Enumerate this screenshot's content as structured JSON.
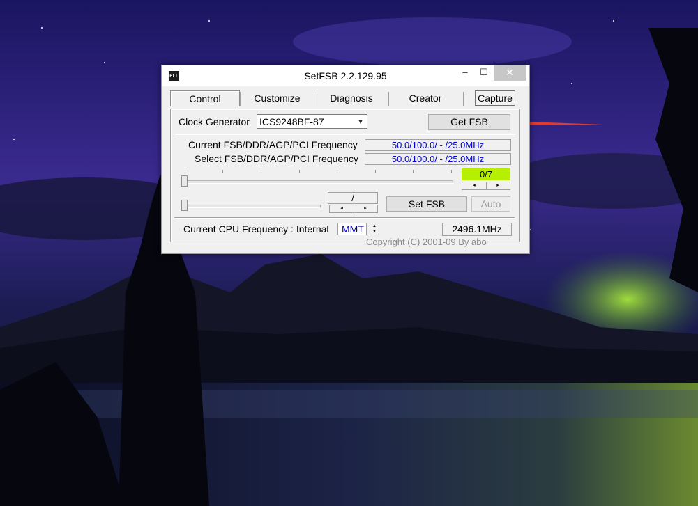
{
  "window": {
    "title": "SetFSB 2.2.129.95",
    "icon_text": "PLL",
    "controls": {
      "minimize": "–",
      "maximize": "☐",
      "close": "✕"
    }
  },
  "tabs": {
    "control": "Control",
    "customize": "Customize",
    "diagnosis": "Diagnosis",
    "creator": "Creator",
    "capture": "Capture"
  },
  "control": {
    "clock_generator_label": "Clock Generator",
    "clock_generator_value": "ICS9248BF-87",
    "get_fsb_button": "Get FSB",
    "current_freq_label": "Current FSB/DDR/AGP/PCI Frequency",
    "current_freq_value": "50.0/100.0/ - /25.0MHz",
    "select_freq_label": "Select FSB/DDR/AGP/PCI Frequency",
    "select_freq_value": "50.0/100.0/ - /25.0MHz",
    "ratio_value": "0/7",
    "secondary_value": "/",
    "set_fsb_button": "Set FSB",
    "auto_button": "Auto",
    "cpu_freq_label": "Current CPU Frequency : Internal",
    "cpu_method": "MMT",
    "cpu_freq_value": "2496.1MHz",
    "copyright": "Copyright (C) 2001-09 By abo",
    "spin_left": "◂",
    "spin_right": "▸",
    "updown_up": "▲",
    "updown_down": "▼"
  },
  "colors": {
    "value_text": "#0000d0",
    "ratio_bg": "#b6f000",
    "annotation_arrow": "#e03b2e"
  }
}
